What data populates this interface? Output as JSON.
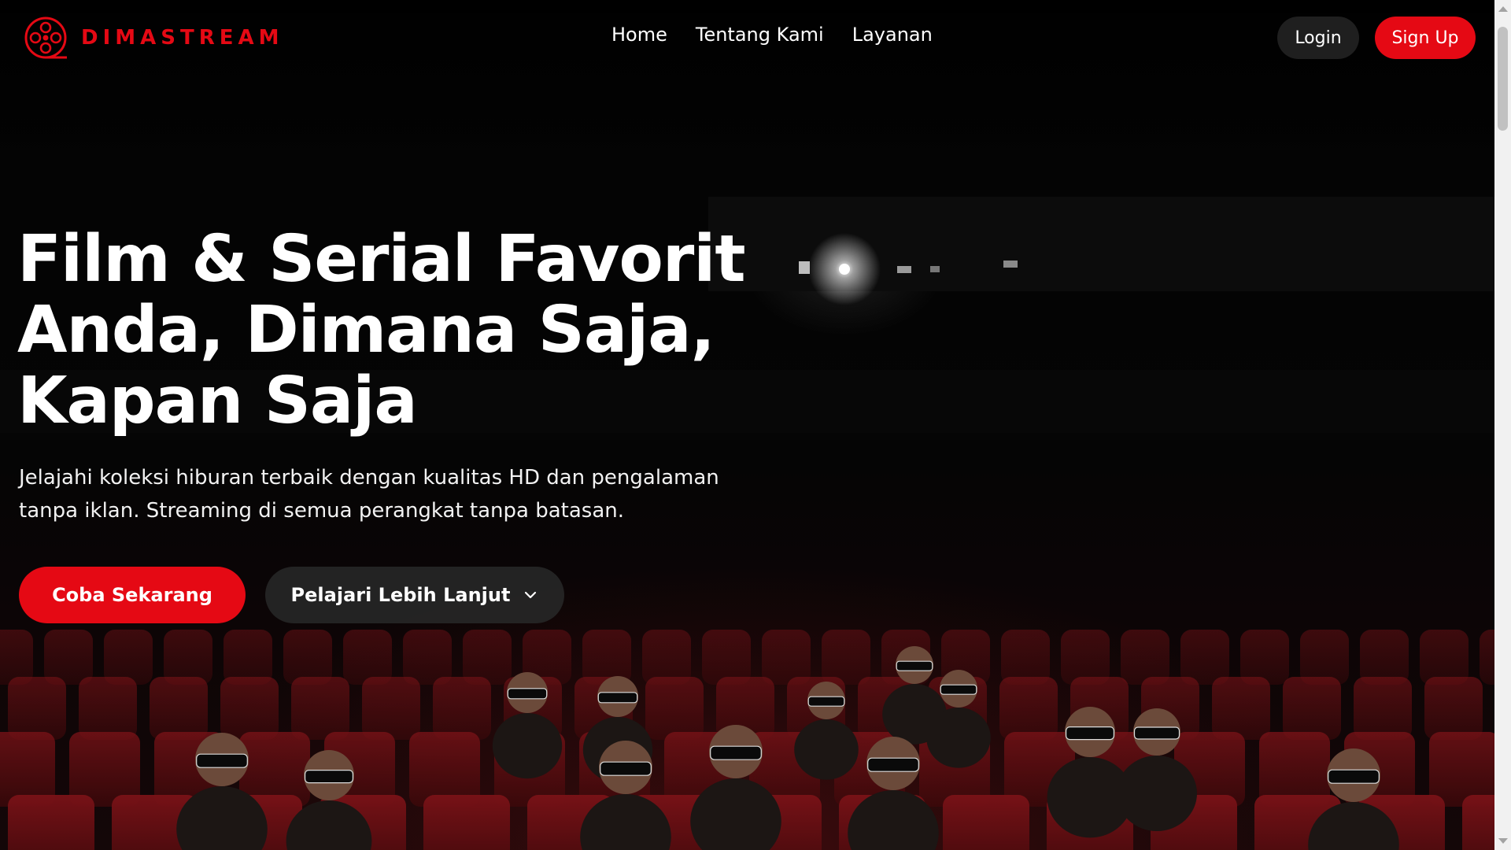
{
  "brand": {
    "name": "DIMASTREAM",
    "logo_icon": "film-reel-icon"
  },
  "nav": {
    "links": [
      {
        "label": "Home"
      },
      {
        "label": "Tentang Kami"
      },
      {
        "label": "Layanan"
      }
    ],
    "login_label": "Login",
    "signup_label": "Sign Up"
  },
  "hero": {
    "title": "Film & Serial Favorit Anda, Dimana Saja, Kapan Saja",
    "subtitle": "Jelajahi koleksi hiburan terbaik dengan kualitas HD dan pengalaman tanpa iklan. Streaming di semua perangkat tanpa batasan.",
    "primary_cta": "Coba Sekarang",
    "secondary_cta": "Pelajari Lebih Lanjut",
    "secondary_cta_icon": "chevron-down-icon",
    "background_image": "cinema-audience-3d-glasses"
  },
  "colors": {
    "accent": "#e50914",
    "background": "#000000",
    "secondary_button": "#262626",
    "login_button": "#1f1f1f",
    "seat_red": "#6e0f13"
  }
}
